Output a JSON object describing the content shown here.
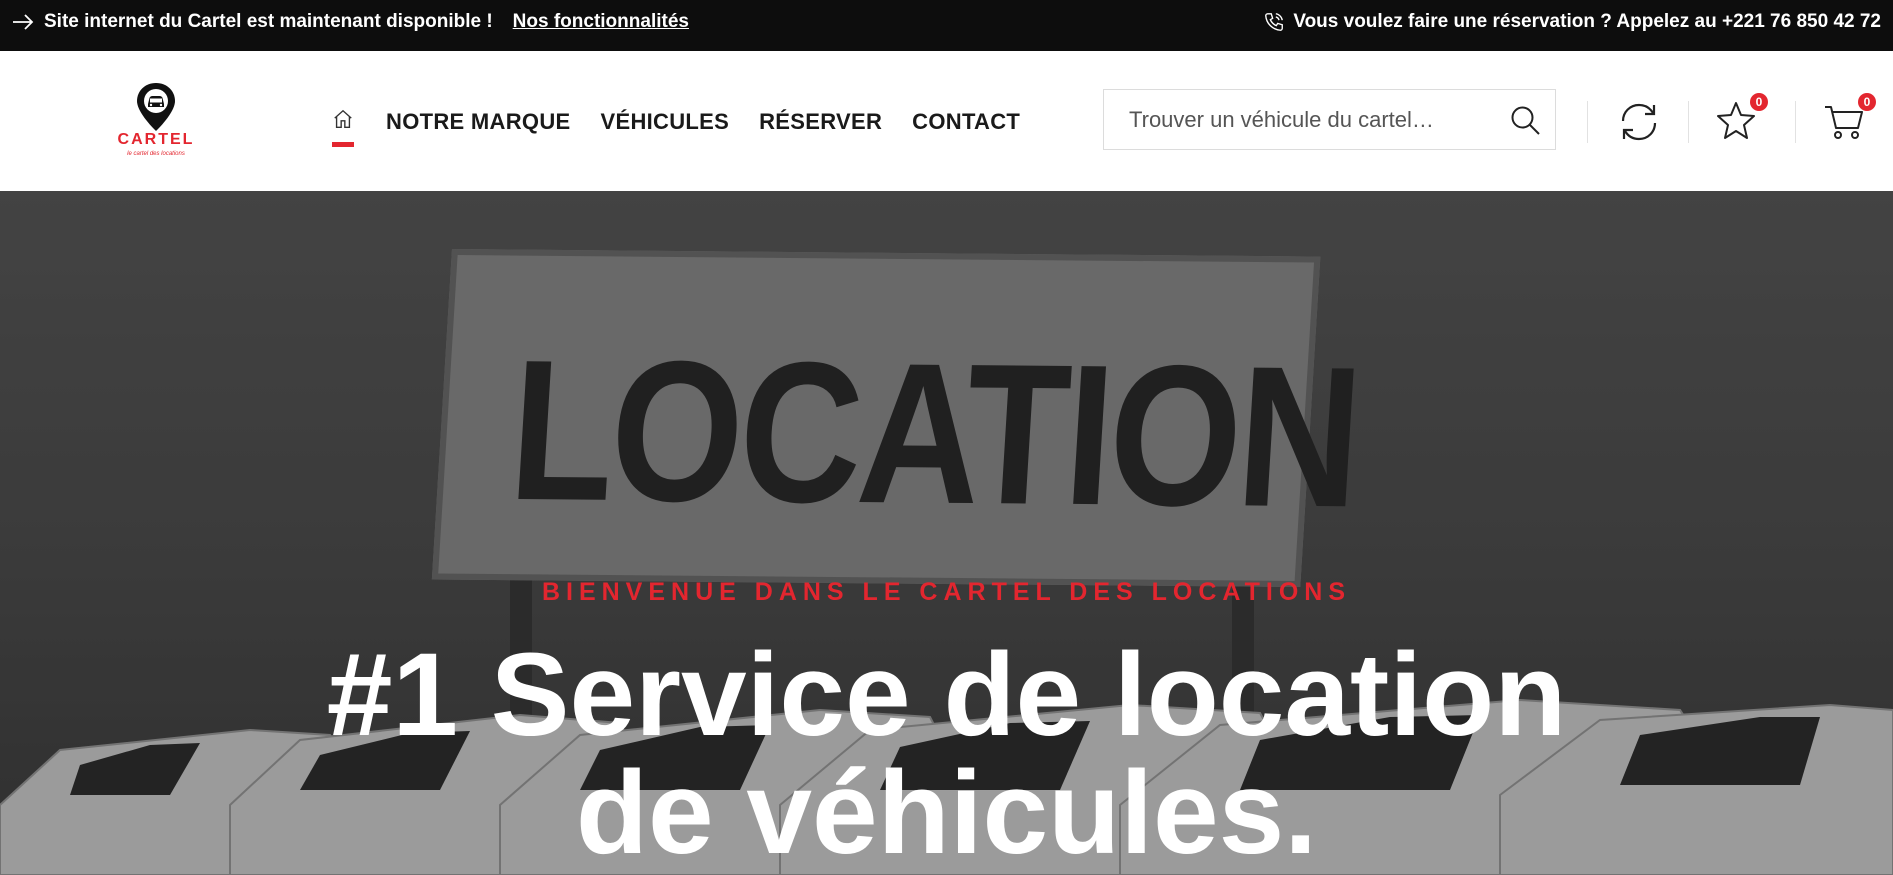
{
  "topbar": {
    "announcement": "Site internet du Cartel est maintenant disponible !",
    "features_link": "Nos fonctionnalités",
    "phone_text": "Vous voulez faire une réservation ? Appelez au +221 76 850 42 72",
    "icons": [
      "arrow-right-icon",
      "phone-icon"
    ]
  },
  "header": {
    "logo": {
      "name": "CARTEL",
      "tagline": "le cartel des locations"
    },
    "nav": {
      "items": [
        {
          "label": "NOTRE MARQUE"
        },
        {
          "label": "VÉHICULES"
        },
        {
          "label": "RÉSERVER"
        },
        {
          "label": "CONTACT"
        }
      ]
    },
    "search": {
      "placeholder": "Trouver un véhicule du cartel…"
    },
    "actions": {
      "wishlist_count": "0",
      "cart_count": "0"
    }
  },
  "hero": {
    "sign_text": "LOCATION",
    "tagline": "BIENVENUE DANS LE CARTEL DES LOCATIONS",
    "title_line1": "#1 Service de location",
    "title_line2": "de véhicules."
  },
  "colors": {
    "accent": "#e3262f",
    "topbar_bg": "#0d0d0d",
    "text_dark": "#1a1a1a"
  }
}
